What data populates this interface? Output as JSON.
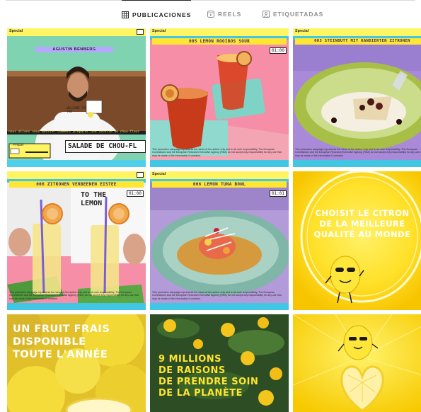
{
  "tabs": [
    {
      "label": "PUBLICACIONES",
      "icon": "grid-icon",
      "active": true
    },
    {
      "label": "REELS",
      "icon": "reels-icon",
      "active": false
    },
    {
      "label": "ETIQUETADAS",
      "icon": "tagged-icon",
      "active": false
    }
  ],
  "posts": {
    "p1": {
      "special": "Special",
      "chef": "AGUSTIN BENBERG",
      "sign": "WELCOME TO THE",
      "caption": "nous allons vous montrer comment préparer une recette de chou-fleur",
      "prepare": "Prepar",
      "dish": "SALADE DE CHOU-FL"
    },
    "p2": {
      "special": "Special",
      "title": "005 LEMON ROOIBOS SOUR",
      "timer": "01:00",
      "disclaimer": "This promotion campaign represents the views of the author only and is his sole responsibility. The European Commission and the European Research Executive Agency (REA) do not accept any responsibility for any use that may be made of the information it contains."
    },
    "p3": {
      "special": "Special",
      "title": "005 STEINBUTT MIT KANDIERTEN ZITRONEN",
      "disclaimer": "This promotion campaign represents the views of the author only and is his sole responsibility. The European Commission and the European Research Executive Agency (REA) do not accept any responsibility for any use that may be made of the information it contains."
    },
    "p4": {
      "title": "006 ZITRONEN VERBEENEN EISTEE",
      "timer": "01:00",
      "sign": "TO THE LEMON",
      "disclaimer": "This promotion campaign represents the views of the author only and is his sole responsibility. The European Commission and the European Research Executive Agency (REA) do not accept any responsibility for any use that may be made of the information it contains."
    },
    "p5": {
      "special": "Special",
      "title": "006 LEMON TUNA BOWL",
      "timer": "01:01",
      "disclaimer": "This promotion campaign represents the views of the author only and is his sole responsibility. The European Commission and the European Research Executive Agency (REA) do not accept any responsibility for any use that may be made of the information it contains."
    },
    "p6": {
      "lines": [
        "CHOISIT LE CITRON",
        "DE LA MEILLEURE",
        "QUALITÉ AU MONDE"
      ]
    },
    "p7": {
      "lines": [
        "UN FRUIT FRAIS",
        "DISPONIBLE",
        "TOUTE L'ANNÉE"
      ]
    },
    "p8": {
      "lines": [
        "9 MILLIONS",
        "DE RAISONS",
        "DE PRENDRE SOIN",
        "DE LA PLANÈTE"
      ]
    },
    "p9": {}
  },
  "colors": {
    "accent_yellow": "#ffe52e",
    "cyan": "#41c6e4",
    "pink": "#f58ea6",
    "purple": "#a98ad8"
  }
}
